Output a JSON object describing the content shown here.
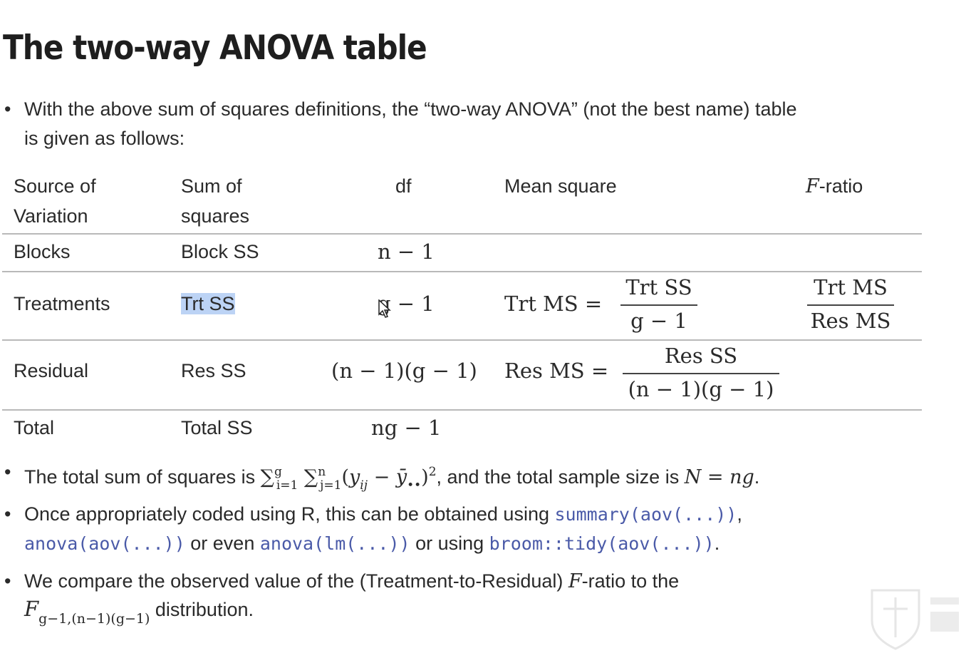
{
  "title": "The two-way ANOVA table",
  "intro": {
    "line1": "With the above sum of squares definitions, the “two-way ANOVA” (not the best name) table",
    "line2": "is given as follows:"
  },
  "table": {
    "headers": {
      "source_1": "Source of",
      "source_2": "Variation",
      "ss_1": "Sum of",
      "ss_2": "squares",
      "df": "df",
      "ms": "Mean square",
      "f_var": "F",
      "f_rest": "-ratio"
    },
    "rows": [
      {
        "source": "Blocks",
        "ss": "Block SS",
        "df": "n − 1"
      },
      {
        "source": "Treatments",
        "ss": "Trt SS",
        "df": "g − 1",
        "ms_label": "Trt MS =",
        "ms_num": "Trt SS",
        "ms_den": "g − 1",
        "f_num": "Trt MS",
        "f_den": "Res MS"
      },
      {
        "source": "Residual",
        "ss": "Res SS",
        "df": "(n − 1)(g − 1)",
        "ms_label": "Res MS =",
        "ms_num": "Res SS",
        "ms_den": "(n − 1)(g − 1)"
      },
      {
        "source": "Total",
        "ss": "Total SS",
        "df": "ng − 1"
      }
    ]
  },
  "bullets": {
    "b1_pre": "The total sum of squares is ",
    "b1_post": ", and the total sample size is ",
    "b1_eq": "N = ng",
    "b1_end": ".",
    "b2_pre": "Once appropriately coded using R, this can be obtained using ",
    "b2_code1": "summary(aov(...))",
    "b2_comma": ",",
    "b2_code2": "anova(aov(...))",
    "b2_mid1": " or even ",
    "b2_code3": "anova(lm(...))",
    "b2_mid2": " or using ",
    "b2_code4": "broom::tidy(aov(...))",
    "b2_end": ".",
    "b3_pre": "We compare the observed value of the (Treatment-to-Residual) ",
    "b3_f": "F",
    "b3_post": "-ratio to the",
    "b3_dist_sub": "g−1,(n−1)(g−1)",
    "b3_dist_end": " distribution."
  },
  "colors": {
    "code": "#4a5aa8",
    "selection": "#bcd3f5",
    "rule": "#b9b9b9"
  },
  "icons": [
    "mouse-cursor-icon",
    "university-crest-icon"
  ]
}
